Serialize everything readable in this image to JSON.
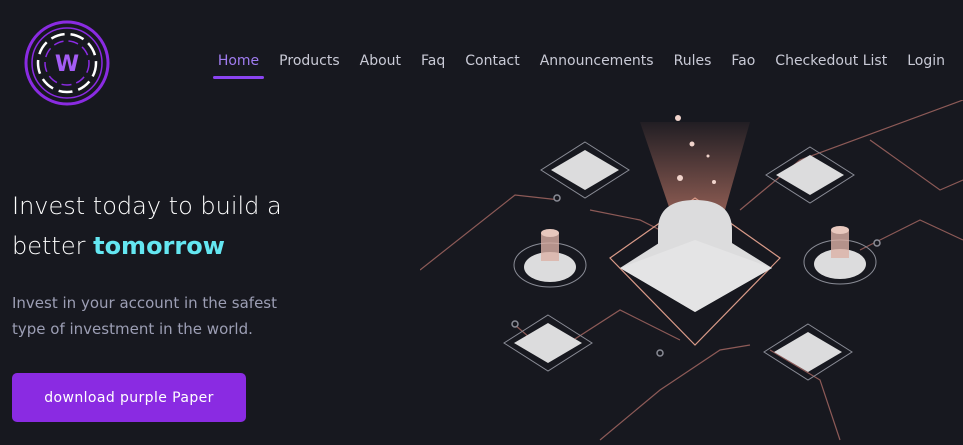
{
  "brand": {
    "logo_letter": "W",
    "accent_color": "#8a2be2",
    "highlight_color": "#64e6f1"
  },
  "nav": {
    "items": [
      {
        "label": "Home",
        "active": true
      },
      {
        "label": "Products"
      },
      {
        "label": "About"
      },
      {
        "label": "Faq"
      },
      {
        "label": "Contact"
      },
      {
        "label": "Announcements"
      },
      {
        "label": "Rules"
      },
      {
        "label": "Fao"
      },
      {
        "label": "Checkedout List"
      },
      {
        "label": "Login"
      }
    ]
  },
  "hero": {
    "title_prefix": "Invest today to build a better",
    "title_accent": "tomorrow",
    "subtitle": "Invest in your account in the safest type of investment in the world.",
    "cta_label": "download purple Paper"
  }
}
